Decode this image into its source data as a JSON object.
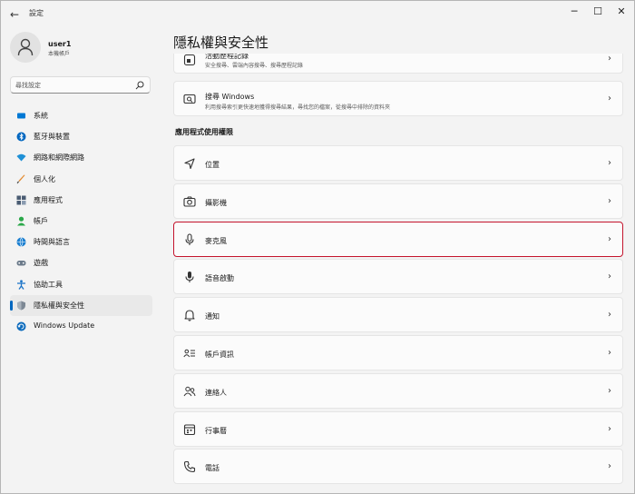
{
  "window": {
    "title": "設定",
    "controls": {
      "minimize": "─",
      "maximize": "☐",
      "close": "✕"
    }
  },
  "profile": {
    "name": "user1",
    "subtitle": "本機帳戶"
  },
  "search": {
    "placeholder": "尋找設定"
  },
  "sidebar": {
    "items": [
      {
        "label": "系統",
        "icon": "system-icon",
        "color": "#0078d4"
      },
      {
        "label": "藍牙與裝置",
        "icon": "bluetooth-icon",
        "color": "#0067c0"
      },
      {
        "label": "網路和網際網路",
        "icon": "wifi-icon",
        "color": "#1e90d6"
      },
      {
        "label": "個人化",
        "icon": "brush-icon",
        "color": "#e38a2f"
      },
      {
        "label": "應用程式",
        "icon": "apps-icon",
        "color": "#4a5c73"
      },
      {
        "label": "帳戶",
        "icon": "account-icon",
        "color": "#2ba84a"
      },
      {
        "label": "時間與語言",
        "icon": "globe-clock-icon",
        "color": "#1b7fd0"
      },
      {
        "label": "遊戲",
        "icon": "gamepad-icon",
        "color": "#6b7a8a"
      },
      {
        "label": "協助工具",
        "icon": "accessibility-icon",
        "color": "#1a73c7"
      },
      {
        "label": "隱私權與安全性",
        "icon": "shield-icon",
        "color": "#7d8894",
        "active": true
      },
      {
        "label": "Windows Update",
        "icon": "update-icon",
        "color": "#0f6cbd"
      }
    ]
  },
  "page": {
    "title": "隱私權與安全性",
    "partial_card": {
      "title": "活動歷程記錄",
      "desc": "安全搜尋、雲端內容搜尋、搜尋歷程記錄"
    },
    "search_windows": {
      "title": "搜尋 Windows",
      "desc": "利用搜尋索引更快速地獲得搜尋結果，尋找您的檔案，從搜尋中排除的資料夾"
    },
    "section_title": "應用程式使用權限",
    "permissions": [
      {
        "label": "位置",
        "icon": "location-icon"
      },
      {
        "label": "攝影機",
        "icon": "camera-icon"
      },
      {
        "label": "麥克風",
        "icon": "microphone-icon",
        "highlight": true
      },
      {
        "label": "語音啟動",
        "icon": "voice-activation-icon"
      },
      {
        "label": "通知",
        "icon": "bell-icon"
      },
      {
        "label": "帳戶資訊",
        "icon": "account-info-icon"
      },
      {
        "label": "連絡人",
        "icon": "contacts-icon"
      },
      {
        "label": "行事曆",
        "icon": "calendar-icon"
      },
      {
        "label": "電話",
        "icon": "phone-icon"
      }
    ],
    "chevron": "›"
  }
}
